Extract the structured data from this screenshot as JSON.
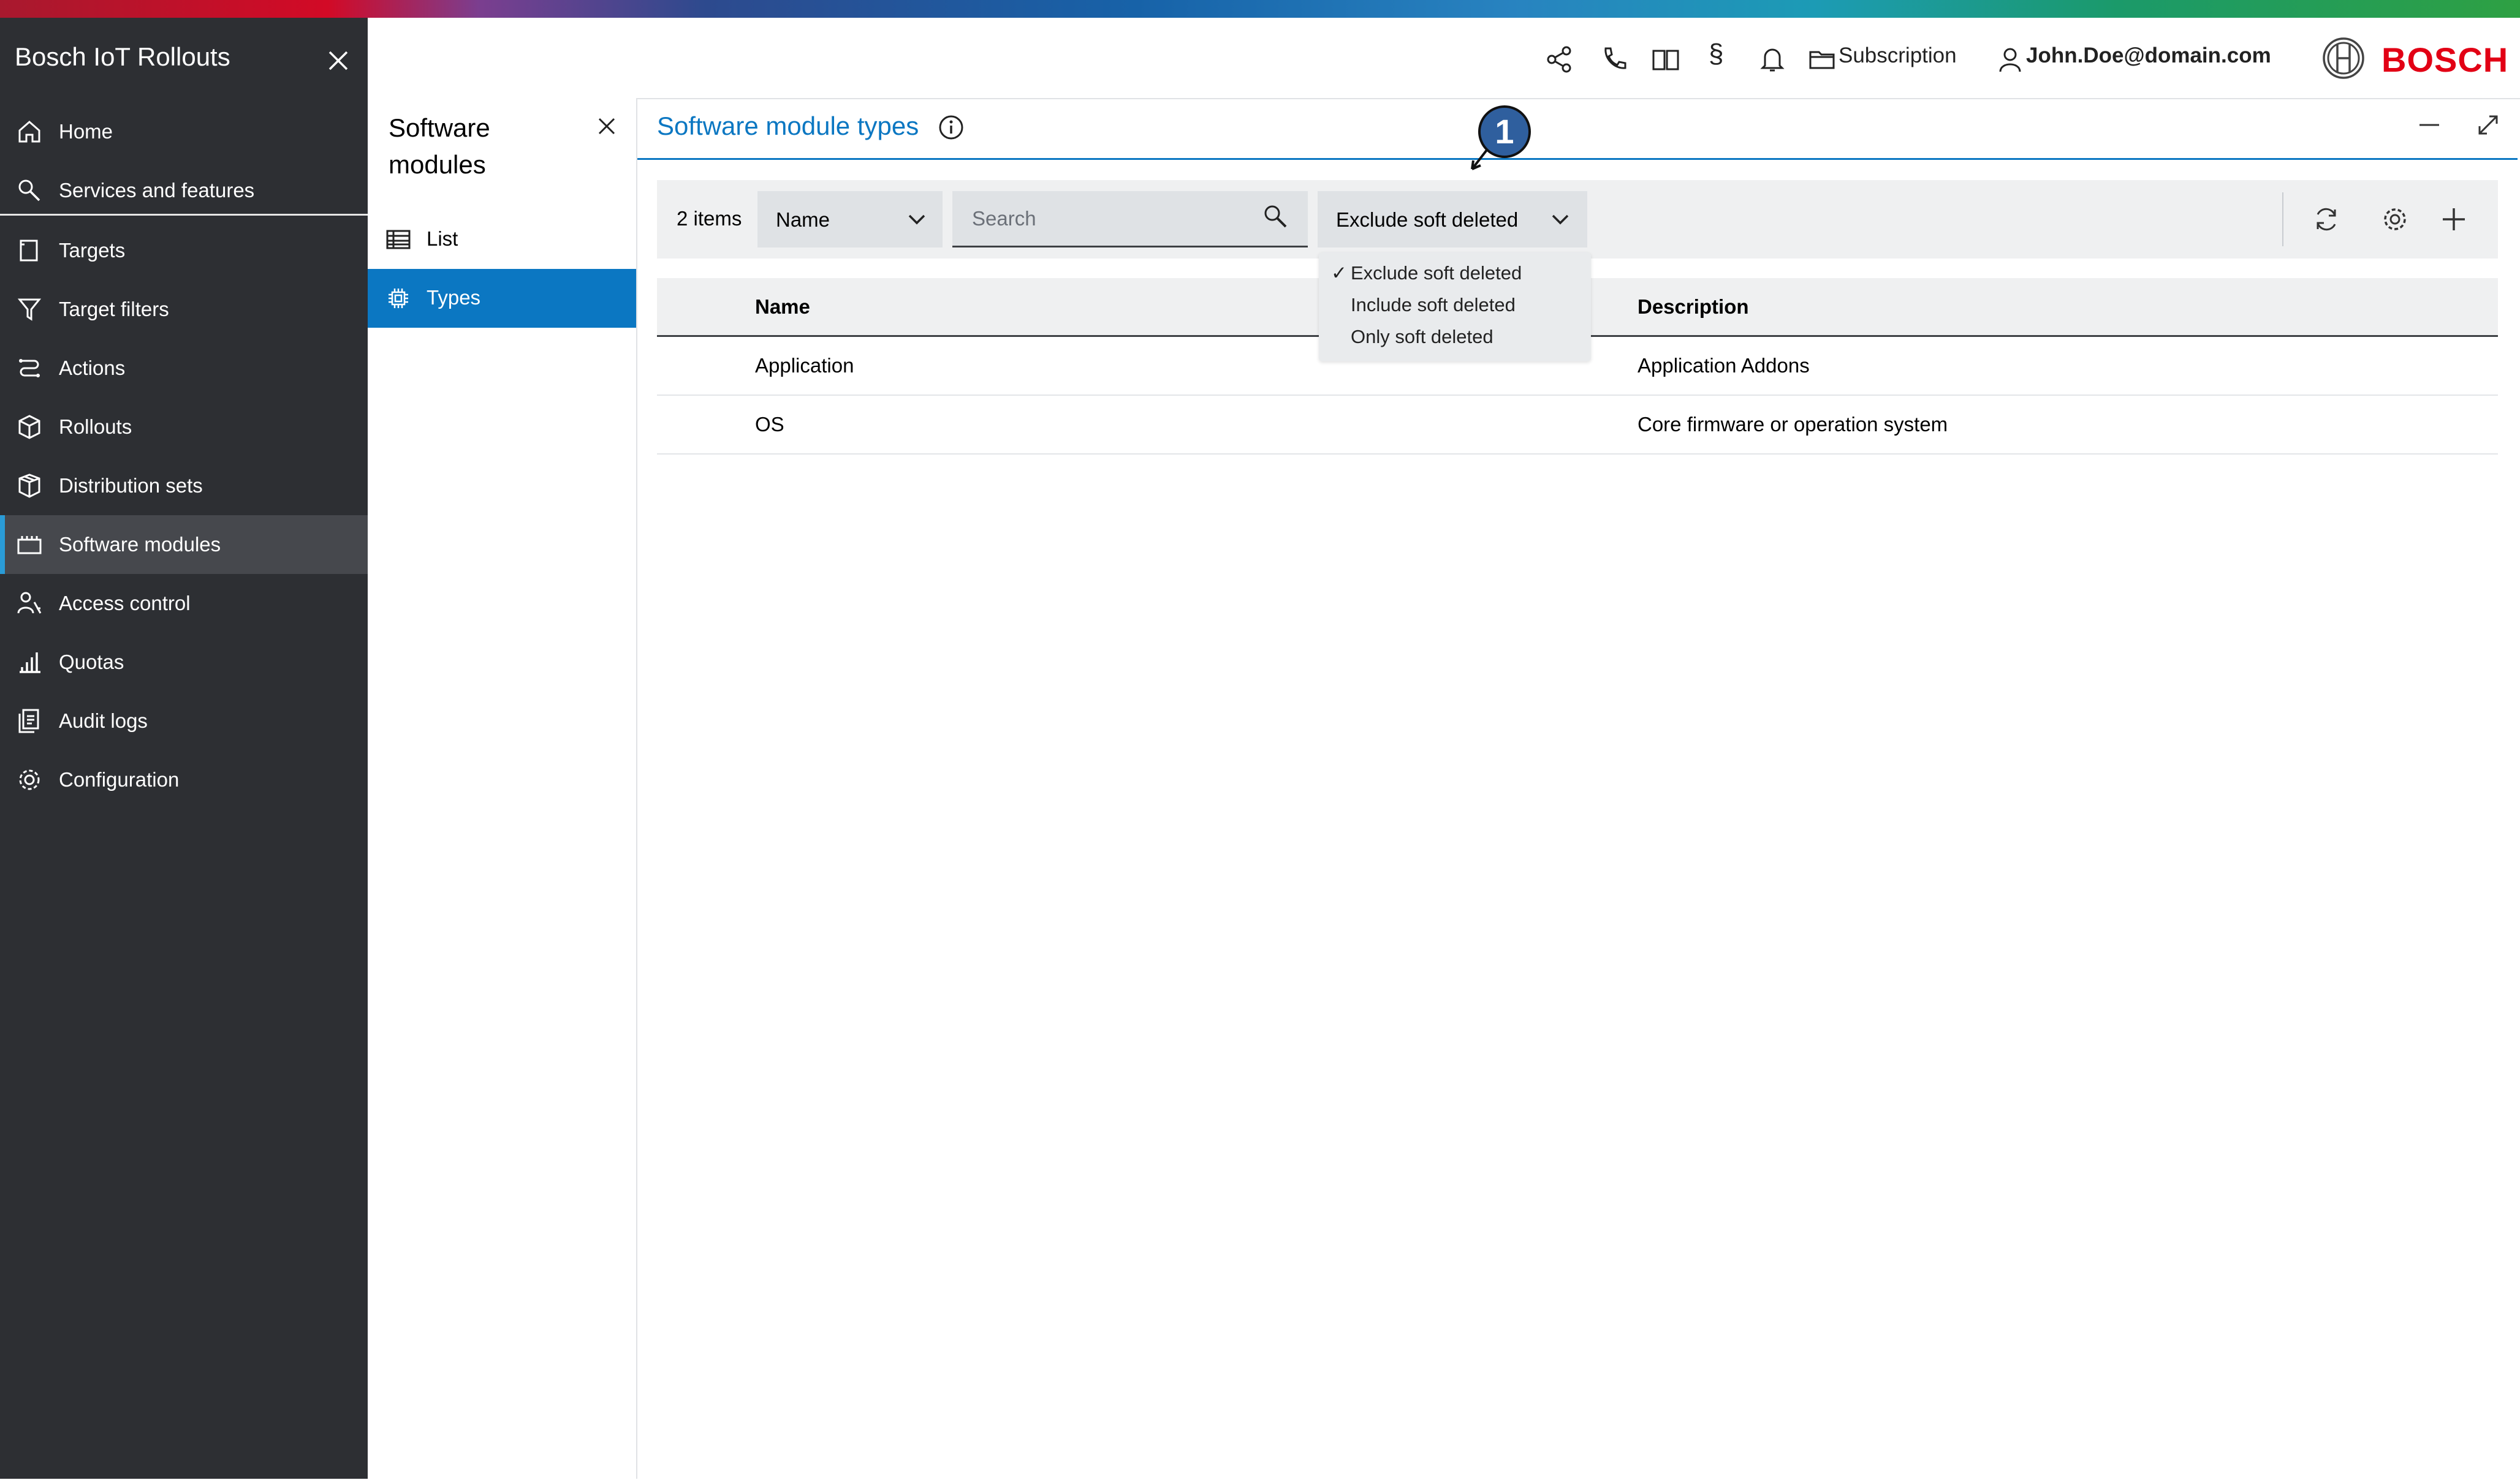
{
  "app": {
    "title": "Bosch IoT Rollouts",
    "brand": "BOSCH",
    "accent_color": "#0b77c2",
    "brand_color": "#e20015",
    "sidebar_bg": "#2d2f33"
  },
  "sidebar": {
    "items": [
      {
        "label": "Home",
        "icon": "home-icon"
      },
      {
        "label": "Services and features",
        "icon": "wrench-icon"
      },
      {
        "label": "Targets",
        "icon": "device-icon"
      },
      {
        "label": "Target filters",
        "icon": "filter-icon"
      },
      {
        "label": "Actions",
        "icon": "actions-icon"
      },
      {
        "label": "Rollouts",
        "icon": "cube-icon"
      },
      {
        "label": "Distribution sets",
        "icon": "package-icon"
      },
      {
        "label": "Software modules",
        "icon": "module-icon",
        "active": true
      },
      {
        "label": "Access control",
        "icon": "access-icon"
      },
      {
        "label": "Quotas",
        "icon": "bar-chart-icon"
      },
      {
        "label": "Audit logs",
        "icon": "log-icon"
      },
      {
        "label": "Configuration",
        "icon": "gear-icon"
      }
    ]
  },
  "subnav": {
    "title": "Software modules",
    "items": [
      {
        "label": "List",
        "icon": "table-icon"
      },
      {
        "label": "Types",
        "icon": "chip-icon",
        "active": true
      }
    ]
  },
  "header": {
    "subscription": "Subscription",
    "user": "John.Doe@domain.com",
    "legal": "§"
  },
  "panel": {
    "title": "Software module types"
  },
  "toolbar": {
    "item_count": "2 items",
    "sort_value": "Name",
    "search_placeholder": "Search",
    "filter_value": "Exclude soft deleted"
  },
  "dropdown": {
    "options": [
      "Exclude soft deleted",
      "Include soft deleted",
      "Only soft deleted"
    ],
    "checkmark": "✓"
  },
  "table": {
    "columns": [
      "Name",
      "Description"
    ],
    "rows": [
      {
        "name": "Application",
        "description": "Application Addons"
      },
      {
        "name": "OS",
        "description": "Core firmware or operation system"
      }
    ]
  },
  "annotation": {
    "marker": "1"
  }
}
